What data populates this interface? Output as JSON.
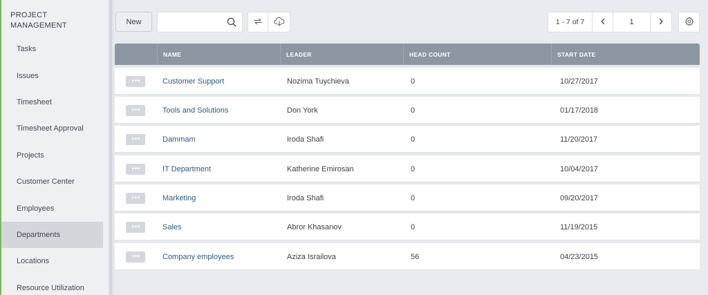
{
  "sidebar": {
    "section_title": "PROJECT MANAGEMENT",
    "items": [
      {
        "label": "Tasks"
      },
      {
        "label": "Issues"
      },
      {
        "label": "Timesheet"
      },
      {
        "label": "Timesheet Approval"
      },
      {
        "label": "Projects"
      },
      {
        "label": "Customer Center"
      },
      {
        "label": "Employees"
      },
      {
        "label": "Departments",
        "active": true
      },
      {
        "label": "Locations"
      },
      {
        "label": "Resource Utilization"
      }
    ]
  },
  "toolbar": {
    "new_label": "New",
    "search": {
      "value": "",
      "placeholder": ""
    },
    "icons": [
      "search-icon",
      "sync-icon",
      "cloud-download-icon",
      "chevron-left-icon",
      "chevron-right-icon",
      "gear-icon"
    ]
  },
  "pager": {
    "range": "1 - 7 of 7",
    "page": "1"
  },
  "table": {
    "columns": [
      "NAME",
      "LEADER",
      "HEAD COUNT",
      "START DATE"
    ],
    "rows": [
      {
        "name": "Customer Support",
        "leader": "Nozima Tuychieva",
        "head_count": "0",
        "start_date": "10/27/2017"
      },
      {
        "name": "Tools and Solutions",
        "leader": "Don York",
        "head_count": "0",
        "start_date": "01/17/2018"
      },
      {
        "name": "Dammam",
        "leader": "Iroda Shafi",
        "head_count": "0",
        "start_date": "11/20/2017"
      },
      {
        "name": "IT Department",
        "leader": "Katherine Emirosan",
        "head_count": "0",
        "start_date": "10/04/2017"
      },
      {
        "name": "Marketing",
        "leader": "Iroda Shafi",
        "head_count": "0",
        "start_date": "09/20/2017"
      },
      {
        "name": "Sales",
        "leader": "Abror Khasanov",
        "head_count": "0",
        "start_date": "11/19/2015"
      },
      {
        "name": "Company employees",
        "leader": "Aziza Israilova",
        "head_count": "56",
        "start_date": "04/23/2015"
      }
    ]
  },
  "colors": {
    "accent": "#7bb661",
    "header_bg": "#8d97a2",
    "link": "#2e5b80",
    "active_nav": "#d3d7dc"
  }
}
